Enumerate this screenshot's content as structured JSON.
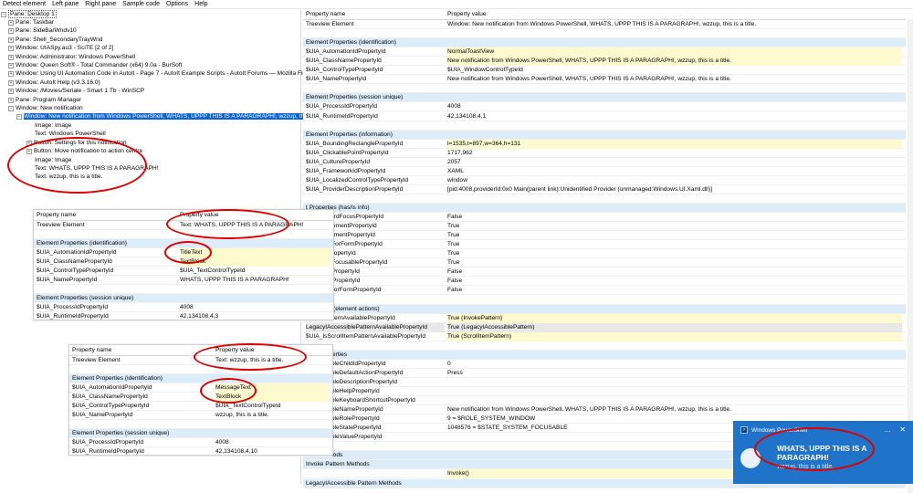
{
  "menu": [
    "Detect element",
    "Left pane",
    "Right pane",
    "Sample code",
    "Options",
    "Help"
  ],
  "tree": {
    "root": "Pane: Desktop 1",
    "items": [
      "Pane: Taskbar",
      "Pane: SideBarWndv10",
      "Pane: Shell_SecondaryTrayWnd",
      "Window: UIASpy.au3 - SciTE [2 of 2]",
      "Window: Administrator: Windows PowerShell",
      "Window: Queen Soft® - Total Commander (x64) 9.0a - BurSoft",
      "Window: Using UI Automation Code in AutoIt - Page 7 - AutoIt Example Scripts - AutoIt Forums — Mozilla Firef",
      "Window: AutoIt Help (v3.3.16.0)",
      "Window: /Movies/Seriale - Smart 1 Tb - WinSCP",
      "Pane: Program Manager",
      "Window: New notification"
    ],
    "selected": "Window: New notification from Windows PowerShell, WHATS, UPPP THIS IS A PARAGRAPH!, wzzup, this is a title.",
    "children": [
      "Image: Image",
      "Text: Windows PowerShell",
      "Button: Settings for this notification",
      "Button: Move notification to action centre",
      "Image: Image",
      "Text: WHATS, UPPP THIS IS A PARAGRAPH!",
      "Text: wzzup, this is a title."
    ]
  },
  "grid": {
    "header_name": "Property name",
    "header_value": "Property value",
    "rows": [
      {
        "k": "Treeview Element",
        "v": "Window: New notification from Windows PowerShell, WHATS, UPPP THIS IS A PARAGRAPH!, wzzup, this is a title.",
        "t": "row"
      },
      {
        "k": "",
        "v": "",
        "t": "row"
      },
      {
        "k": "Element Properties (identification)",
        "v": "",
        "t": "sec"
      },
      {
        "k": "$UIA_AutomationIdPropertyId",
        "v": "NormalToastView",
        "t": "hl"
      },
      {
        "k": "$UIA_ClassNamePropertyId",
        "v": "New notification from Windows PowerShell, WHATS, UPPP THIS IS A PARAGRAPH!, wzzup, this is a title.",
        "t": "hl"
      },
      {
        "k": "$UIA_ControlTypePropertyId",
        "v": "$UIA_WindowControlTypeId",
        "t": "row"
      },
      {
        "k": "$UIA_NamePropertyId",
        "v": "New notification from Windows PowerShell, WHATS, UPPP THIS IS A PARAGRAPH!, wzzup, this is a title.",
        "t": "row"
      },
      {
        "k": "",
        "v": "",
        "t": "row"
      },
      {
        "k": "Element Properties (session unique)",
        "v": "",
        "t": "sec"
      },
      {
        "k": "$UIA_ProcessIdPropertyId",
        "v": "4008",
        "t": "row"
      },
      {
        "k": "$UIA_RuntimeIdPropertyId",
        "v": "42,134108,4,1",
        "t": "row"
      },
      {
        "k": "",
        "v": "",
        "t": "row"
      },
      {
        "k": "Element Properties (information)",
        "v": "",
        "t": "sec"
      },
      {
        "k": "$UIA_BoundingRectanglePropertyId",
        "v": "l=1535,t=897,w=364,h=131",
        "t": "hl"
      },
      {
        "k": "$UIA_ClickablePointPropertyId",
        "v": "1717,962",
        "t": "row"
      },
      {
        "k": "$UIA_CulturePropertyId",
        "v": "2057",
        "t": "row"
      },
      {
        "k": "$UIA_FrameworkIdPropertyId",
        "v": "XAML",
        "t": "row"
      },
      {
        "k": "$UIA_LocalizedControlTypePropertyId",
        "v": "window",
        "t": "row"
      },
      {
        "k": "$UIA_ProviderDescriptionPropertyId",
        "v": "[pid:4008,providerId:0x0 Main(parent link):Unidentified Provider (unmanaged:Windows.UI.Xaml.dll)]",
        "t": "row"
      },
      {
        "k": "",
        "v": "",
        "t": "row"
      },
      {
        "k": "t Properties (has/is info)",
        "v": "",
        "t": "sec"
      },
      {
        "k": "lasKeyboardFocusPropertyId",
        "v": "False",
        "t": "row"
      },
      {
        "k": "ContentElementPropertyId",
        "v": "True",
        "t": "row"
      },
      {
        "k": "ControlElementPropertyId",
        "v": "True",
        "t": "row"
      },
      {
        "k": "DataValidForFormPropertyId",
        "v": "True",
        "t": "row"
      },
      {
        "k": "EnabledPropertyId",
        "v": "True",
        "t": "row"
      },
      {
        "k": "KeyboardFocusablePropertyId",
        "v": "True",
        "t": "row"
      },
      {
        "k": "OffscreenPropertyId",
        "v": "False",
        "t": "row"
      },
      {
        "k": "PasswordPropertyId",
        "v": "False",
        "t": "row"
      },
      {
        "k": "RequiredForFormPropertyId",
        "v": "False",
        "t": "row"
      },
      {
        "k": "",
        "v": "",
        "t": "row"
      },
      {
        "k": "t Patterns (element actions)",
        "v": "",
        "t": "sec"
      },
      {
        "k": "InvokePatternAvailablePropertyId",
        "v": "True (InvokePattern)",
        "t": "hl"
      },
      {
        "k": "LegacyIAccessiblePatternAvailablePropertyId",
        "v": "True (LegacyIAccessiblePattern)",
        "t": "sel"
      },
      {
        "k": "$UIA_IsScrollItemPatternAvailablePropertyId",
        "v": "True (ScrollItemPattern)",
        "t": "hl"
      },
      {
        "k": "",
        "v": "",
        "t": "row"
      },
      {
        "k": "ttern Properties",
        "v": "",
        "t": "sec"
      },
      {
        "k": "yIAccessibleChildIdPropertyId",
        "v": "0",
        "t": "row"
      },
      {
        "k": "yIAccessibleDefaultActionPropertyId",
        "v": "Press",
        "t": "row"
      },
      {
        "k": "yIAccessibleDescriptionPropertyId",
        "v": "",
        "t": "row"
      },
      {
        "k": "yIAccessibleHelpPropertyId",
        "v": "",
        "t": "row"
      },
      {
        "k": "yIAccessibleKeyboardShortcutPropertyId",
        "v": "",
        "t": "row"
      },
      {
        "k": "yIAccessibleNamePropertyId",
        "v": "New notification from Windows PowerShell, WHATS, UPPP THIS IS A PARAGRAPH!, wzzup, this is a title.",
        "t": "row"
      },
      {
        "k": "yIAccessibleRolePropertyId",
        "v": "9 = $ROLE_SYSTEM_WINDOW",
        "t": "row"
      },
      {
        "k": "yIAccessibleStatePropertyId",
        "v": "1048576 = $STATE_SYSTEM_FOCUSABLE",
        "t": "row"
      },
      {
        "k": "yIAccessibleValuePropertyId",
        "v": "",
        "t": "row"
      },
      {
        "k": "",
        "v": "",
        "t": "row"
      },
      {
        "k": "ttern Methods",
        "v": "",
        "t": "sec"
      },
      {
        "k": "Invoke Pattern Methods",
        "v": "",
        "t": "sec"
      },
      {
        "k": "",
        "v": "Invoke()",
        "t": "hl"
      },
      {
        "k": "LegacyIAccessible Pattern Methods",
        "v": "",
        "t": "sec"
      }
    ]
  },
  "panel1": {
    "header_name": "Property name",
    "header_value": "Property value",
    "rows": [
      {
        "k": "Treeview Element",
        "v": "Text: WHATS, UPPP THIS IS A PARAGRAPH!",
        "t": "row"
      },
      {
        "k": "",
        "v": "",
        "t": "row"
      },
      {
        "k": "Element Properties (identification)",
        "v": "",
        "t": "sec"
      },
      {
        "k": "$UIA_AutomationIdPropertyId",
        "v": "TitleText",
        "t": "hl"
      },
      {
        "k": "$UIA_ClassNamePropertyId",
        "v": "TextBlock",
        "t": "hl"
      },
      {
        "k": "$UIA_ControlTypePropertyId",
        "v": "$UIA_TextControlTypeId",
        "t": "row"
      },
      {
        "k": "$UIA_NamePropertyId",
        "v": "WHATS, UPPP THIS IS A PARAGRAPH!",
        "t": "row"
      },
      {
        "k": "",
        "v": "",
        "t": "row"
      },
      {
        "k": "Element Properties (session unique)",
        "v": "",
        "t": "sec"
      },
      {
        "k": "$UIA_ProcessIdPropertyId",
        "v": "4008",
        "t": "row"
      },
      {
        "k": "$UIA_RuntimeIdPropertyId",
        "v": "42,134108,4,3",
        "t": "row"
      }
    ]
  },
  "panel2": {
    "header_name": "Property name",
    "header_value": "Property value",
    "rows": [
      {
        "k": "Treeview Element",
        "v": "Text: wzzup, this is a title.",
        "t": "row"
      },
      {
        "k": "",
        "v": "",
        "t": "row"
      },
      {
        "k": "Element Properties (identification)",
        "v": "",
        "t": "sec"
      },
      {
        "k": "$UIA_AutomationIdPropertyId",
        "v": "MessageText",
        "t": "hl"
      },
      {
        "k": "$UIA_ClassNamePropertyId",
        "v": "TextBlock",
        "t": "hl"
      },
      {
        "k": "$UIA_ControlTypePropertyId",
        "v": "$UIA_TextControlTypeId",
        "t": "row"
      },
      {
        "k": "$UIA_NamePropertyId",
        "v": "wzzup, this is a title.",
        "t": "row"
      },
      {
        "k": "",
        "v": "",
        "t": "row"
      },
      {
        "k": "Element Properties (session unique)",
        "v": "",
        "t": "sec"
      },
      {
        "k": "$UIA_ProcessIdPropertyId",
        "v": "4008",
        "t": "row"
      },
      {
        "k": "$UIA_RuntimeIdPropertyId",
        "v": "42,134108,4,10",
        "t": "row"
      }
    ]
  },
  "toast": {
    "app": "Windows PowerShell",
    "title": "WHATS, UPPP THIS IS A PARAGRAPH!",
    "message": "wzzup, this is a title.",
    "controls": [
      "...",
      "✕"
    ]
  },
  "colors": {
    "selection": "#0a64d6",
    "section": "#dcecf8",
    "highlight": "#fdfad0",
    "annotation": "#e00000",
    "toast": "#1f73c8"
  }
}
